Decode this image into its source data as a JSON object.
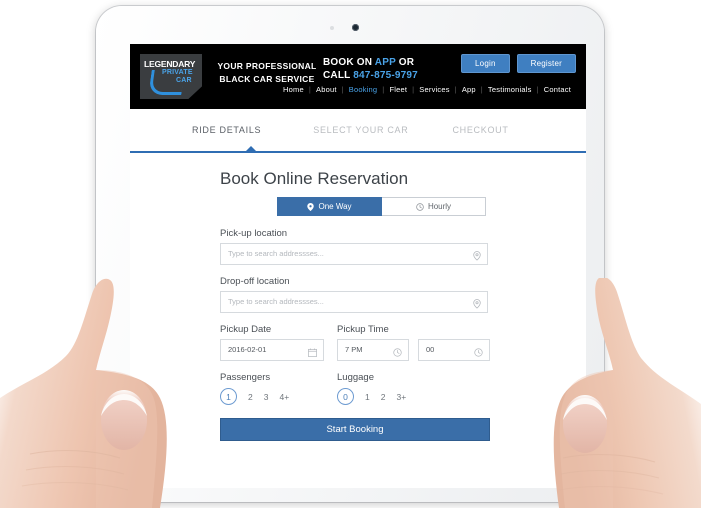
{
  "device": {
    "type": "tablet",
    "camera_icon": "camera-dot",
    "sensor_icon": "sensor-dot"
  },
  "header": {
    "logo": {
      "line1": "LEGENDARY",
      "line2": "PRIVATE",
      "line3": "CAR",
      "accent_color": "#4aa3e8"
    },
    "tagline_line1": "YOUR PROFESSIONAL",
    "tagline_line2": "BLACK CAR SERVICE",
    "book_prefix": "BOOK ON",
    "book_accent": "APP",
    "book_suffix": "OR",
    "call_label": "CALL",
    "phone": "847-875-9797",
    "login_label": "Login",
    "register_label": "Register",
    "nav": [
      {
        "label": "Home",
        "active": false
      },
      {
        "label": "About",
        "active": false
      },
      {
        "label": "Booking",
        "active": true
      },
      {
        "label": "Fleet",
        "active": false
      },
      {
        "label": "Services",
        "active": false
      },
      {
        "label": "App",
        "active": false
      },
      {
        "label": "Testimonials",
        "active": false
      },
      {
        "label": "Contact",
        "active": false
      }
    ],
    "nav_separator": "|",
    "background_color": "#000000",
    "button_color": "#3f7fc1"
  },
  "steps": {
    "tab1": "RIDE DETAILS",
    "tab2": "SELECT YOUR CAR",
    "tab3": "CHECKOUT",
    "active_index": 0,
    "divider_color": "#2f6db3"
  },
  "form": {
    "title": "Book Online Reservation",
    "trip_type": {
      "one_way_label": "One Way",
      "one_way_icon": "map-pin-icon",
      "hourly_label": "Hourly",
      "hourly_icon": "clock-icon",
      "selected": "One Way"
    },
    "pickup_location": {
      "label": "Pick-up location",
      "value": "",
      "placeholder": "Type to search addressses...",
      "icon": "map-pin-icon"
    },
    "dropoff_location": {
      "label": "Drop-off location",
      "value": "",
      "placeholder": "Type to search addressses...",
      "icon": "map-pin-icon"
    },
    "pickup_date": {
      "label": "Pickup Date",
      "value": "2016-02-01",
      "icon": "calendar-icon"
    },
    "pickup_time": {
      "label": "Pickup Time",
      "hour_value": "7 PM",
      "minute_value": "00",
      "icon": "clock-icon"
    },
    "passengers": {
      "label": "Passengers",
      "options": [
        "1",
        "2",
        "3",
        "4+"
      ],
      "selected": "1"
    },
    "luggage": {
      "label": "Luggage",
      "options": [
        "0",
        "1",
        "2",
        "3+"
      ],
      "selected": "0"
    },
    "submit_label": "Start Booking",
    "accent_color": "#3a6ea8"
  }
}
